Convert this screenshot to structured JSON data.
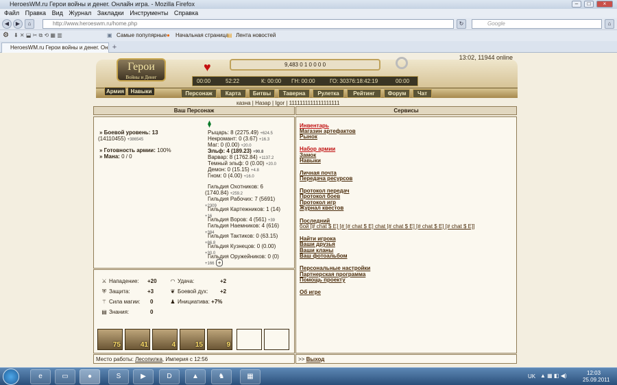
{
  "browser": {
    "title": "HeroesWM.ru Герои войны и денег. Онлайн игра. - Mozilla Firefox",
    "menu": [
      "Файл",
      "Правка",
      "Вид",
      "Журнал",
      "Закладки",
      "Инструменты",
      "Справка"
    ],
    "url": "http://www.heroeswm.ru/home.php",
    "search_placeholder": "Google",
    "bookmarks": [
      "Самые популярные",
      "Начальная страница",
      "Лента новостей"
    ],
    "tab_title": "HeroesWM.ru Герои войны и денег. Он..."
  },
  "header": {
    "clock": "13:02, 11944 online",
    "logo": "Герои",
    "logo_sub": "Войны и Денег",
    "resources": "9,483 0 1 0 0 0 0",
    "timers": [
      "00:00",
      "52:22",
      "К: 00:00",
      "ГН: 00:00",
      "ГО: 30376:18:42:19",
      "00:00"
    ],
    "side_nav": [
      "Армия",
      "Навыки"
    ],
    "nav": [
      "Персонаж",
      "Карта",
      "Битвы",
      "Таверна",
      "Рулетка",
      "Рейтинг",
      "Форум",
      "Чат"
    ],
    "sublinks": "казна | Назар | Igor | 1111111111111111111"
  },
  "character": {
    "heading": "Ваш Персонаж",
    "combat_label": "» Боевой уровень:",
    "combat_level": "13",
    "exp": "(14110455)",
    "exp_gain": "+386545",
    "readiness_label": "» Готовность армии:",
    "readiness": "100%",
    "mana_label": "» Мана:",
    "mana": "0 / 0",
    "factions": [
      {
        "t": "Рыцарь: 8 (2275.49)",
        "g": "+624.5"
      },
      {
        "t": "Некромант: 0 (3.67)",
        "g": "+16.3"
      },
      {
        "t": "Маг: 0 (0.00)",
        "g": "+20.0"
      },
      {
        "t": "Эльф: 4 (189.23)",
        "g": "+90.8"
      },
      {
        "t": "Варвар: 8 (1762.84)",
        "g": "+1137.2"
      },
      {
        "t": "Темный эльф: 0 (0.00)",
        "g": "+20.0"
      },
      {
        "t": "Демон: 0 (15.15)",
        "g": "+4.8"
      },
      {
        "t": "Гном: 0 (4.00)",
        "g": "+16.0"
      }
    ],
    "guilds": [
      {
        "t": "Гильдия Охотников: 6",
        "t2": "(1740.84)",
        "g": "+259.2"
      },
      {
        "t": "Гильдия Рабочих: 7 (5691)",
        "g": "+2309"
      },
      {
        "t": "Гильдия Картежников: 1 (14)",
        "g": "+16"
      },
      {
        "t": "Гильдия Воров: 4 (561)",
        "g": "+39"
      },
      {
        "t": "Гильдия Наемников: 4 (616)",
        "g": "+384"
      },
      {
        "t": "Гильдия Тактиков: 0 (63.15)",
        "g": "+86.8"
      },
      {
        "t": "Гильдия Кузнецов: 0 (0.00)",
        "g": "+30.0"
      },
      {
        "t": "Гильдия Оружейников: 0 (0)",
        "g": "+166"
      }
    ],
    "plus": "+"
  },
  "stats": {
    "attack_label": "Нападение:",
    "attack": "+20",
    "luck_label": "Удача:",
    "luck": "+2",
    "defense_label": "Защита:",
    "defense": "+3",
    "morale_label": "Боевой дух:",
    "morale": "+2",
    "spell_label": "Сила магии:",
    "spell": "0",
    "initiative_label": "Инициатива:",
    "initiative": "+7%",
    "knowledge_label": "Знания:",
    "knowledge": "0"
  },
  "army": [
    "75",
    "41",
    "4",
    "15",
    "9",
    "",
    ""
  ],
  "work": {
    "label": "Место работы:",
    "place": "Лесопилка",
    "tail": ", Империя с 12:56"
  },
  "services": {
    "heading": "Сервисы",
    "groups": [
      [
        "Инвентарь",
        "Магазин артефактов",
        "Рынок"
      ],
      [
        "Набор армии",
        "Замок",
        "Навыки"
      ],
      [
        "Личная почта",
        "Передача ресурсов"
      ],
      [
        "Протокол передач",
        "Протокол боев",
        "Протокол игр",
        "Журнал квестов"
      ]
    ],
    "last_battles_label": "Последний",
    "last_battles": "бой [# chat $ E] [# [# chat $ E] chat [# chat $ E] [# chat $ E] [# chat $ E]]",
    "groups2": [
      [
        "Найти игрока",
        "Ваши друзья",
        "Ваши кланы",
        "Ваш фотоальбом"
      ],
      [
        "Персональные настройки",
        "Партнерская программа",
        "Помощь проекту"
      ],
      [
        "Об игре"
      ]
    ],
    "exit_prefix": ">>",
    "exit": "Выход"
  },
  "taskbar": {
    "lang": "UK",
    "time": "12:03",
    "date": "25.09.2011"
  }
}
